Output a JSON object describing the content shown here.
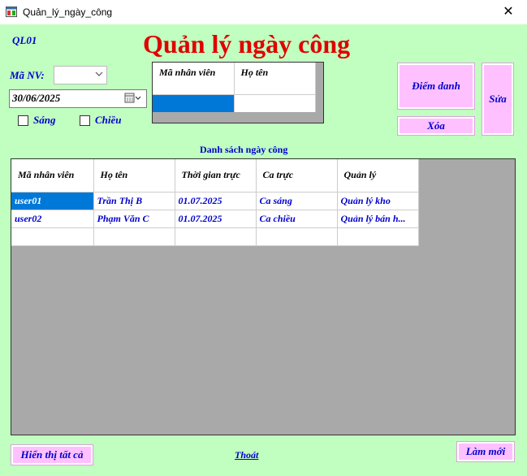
{
  "window": {
    "title": "Quản_lý_ngày_công",
    "close_glyph": "✕"
  },
  "form": {
    "record_id": "QL01",
    "heading": "Quản lý ngày công",
    "employee_label": "Mã NV:",
    "employee_value": "",
    "date_value": "30/06/2025",
    "shift_morning": "Sáng",
    "shift_afternoon": "Chiều"
  },
  "small_grid": {
    "columns": [
      "Mã nhân viên",
      "Họ tên"
    ]
  },
  "buttons": {
    "check_in": "Điểm danh",
    "delete": "Xóa",
    "edit": "Sửa",
    "show_all": "Hiển thị tất cả",
    "refresh": "Làm mới",
    "exit": "Thoát"
  },
  "attendance": {
    "title": "Danh sách ngày công",
    "columns": [
      "Mã nhân viên",
      "Họ tên",
      "Thời gian trực",
      "Ca trực",
      "Quản lý"
    ],
    "rows": [
      [
        "user01",
        "Trần Thị B",
        "01.07.2025",
        "Ca sáng",
        "Quản lý kho"
      ],
      [
        "user02",
        "Phạm Văn C",
        "01.07.2025",
        "Ca chiều",
        "Quản lý bán h..."
      ]
    ]
  },
  "icons": {
    "app": "window-app-icon",
    "close": "close-icon",
    "dropdown": "chevron-down-icon",
    "calendar": "calendar-icon"
  },
  "colors": {
    "background": "#c0ffc0",
    "heading": "#e00000",
    "accent_text": "#0000cc",
    "button": "#ffc0ff",
    "selection": "#0078d7"
  }
}
